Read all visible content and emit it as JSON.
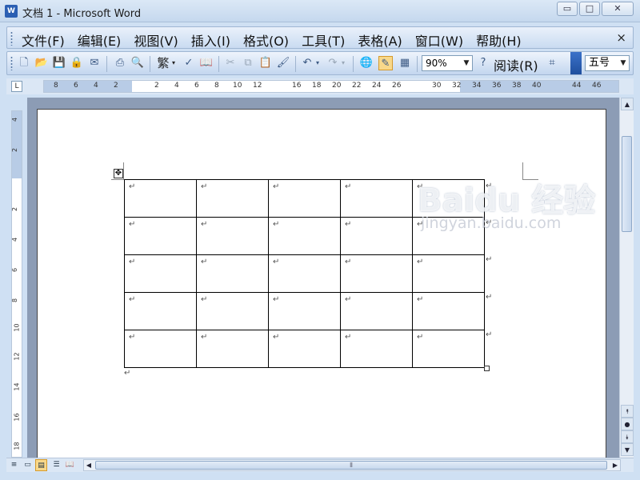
{
  "window": {
    "app_icon": "W",
    "title": "文档 1 - Microsoft Word",
    "min_label": "▭",
    "max_label": "□",
    "close_label": "✕"
  },
  "menu": {
    "items": [
      {
        "label": "文件(F)"
      },
      {
        "label": "编辑(E)"
      },
      {
        "label": "视图(V)"
      },
      {
        "label": "插入(I)"
      },
      {
        "label": "格式(O)"
      },
      {
        "label": "工具(T)"
      },
      {
        "label": "表格(A)"
      },
      {
        "label": "窗口(W)"
      },
      {
        "label": "帮助(H)"
      }
    ],
    "close_label": "×"
  },
  "toolbar": {
    "traditional_label": "繁",
    "zoom": "90%",
    "read_label": "阅读(R)",
    "font_size": "五号"
  },
  "ruler": {
    "corner": "L",
    "h_ticks": [
      "8",
      "6",
      "4",
      "2",
      "2",
      "4",
      "6",
      "8",
      "10",
      "12",
      "16",
      "18",
      "20",
      "22",
      "24",
      "26",
      "30",
      "32",
      "34",
      "36",
      "38",
      "40",
      "44",
      "46"
    ],
    "v_ticks": [
      "4",
      "2",
      "2",
      "4",
      "6",
      "8",
      "10",
      "12",
      "14",
      "16",
      "18"
    ]
  },
  "document": {
    "paragraph_mark": "↵",
    "table_rows": 5,
    "table_cols": 5,
    "table_handle": "✥"
  },
  "scrollbar": {
    "up": "▲",
    "down": "▼",
    "prev_page": "⯭",
    "select_browse": "●",
    "next_page": "⯯"
  },
  "watermark": {
    "brand": "Baidu 经验",
    "url": "jingyan.baidu.com"
  }
}
